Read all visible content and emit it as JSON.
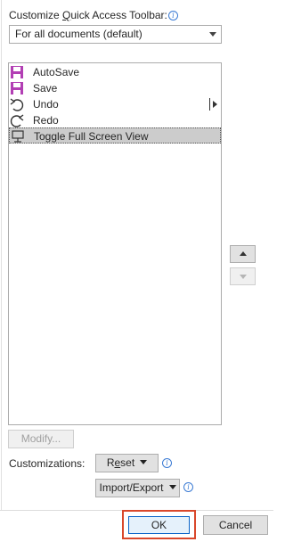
{
  "header": {
    "label_prefix": "Customize ",
    "label_accel": "Q",
    "label_suffix": "uick Access Toolbar:",
    "info_icon": "info-icon"
  },
  "scope_dropdown": {
    "selected": "For all documents (default)"
  },
  "toolbar_items": [
    {
      "label": "AutoSave",
      "icon": "save-icon",
      "color": "#b23fb4"
    },
    {
      "label": "Save",
      "icon": "save-icon",
      "color": "#b23fb4"
    },
    {
      "label": "Undo",
      "icon": "undo-icon",
      "has_submenu": true
    },
    {
      "label": "Redo",
      "icon": "redo-icon"
    },
    {
      "label": "Toggle Full Screen View",
      "icon": "full-screen-icon",
      "selected": true
    }
  ],
  "buttons": {
    "modify": "Modify...",
    "reset": "Reset",
    "reset_accel": "e",
    "import_export": "Import/Export",
    "ok": "OK",
    "cancel": "Cancel"
  },
  "customizations_label": "Customizations:",
  "colors": {
    "accent_focus": "#0a64c8",
    "highlight_box": "#d9472b",
    "save_icon": "#b23fb4"
  }
}
